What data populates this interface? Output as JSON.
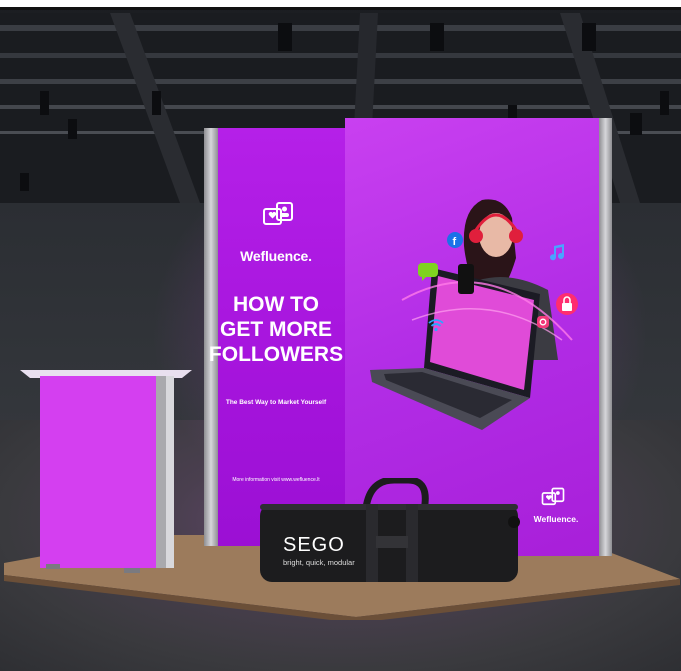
{
  "booth": {
    "brand_name": "Wefluence.",
    "headline_line1": "HOW TO",
    "headline_line2": "GET MORE",
    "headline_line3": "FOLLOWERS",
    "tagline": "The Best Way to Market Yourself",
    "more_info": "More information visit www.wefluence.lt",
    "brand_name_small": "Wefluence."
  },
  "bag": {
    "brand": "SEGO",
    "slogan": "bright, quick, modular"
  },
  "colors": {
    "panel_purple": "#b22de6",
    "counter_pink": "#d43ff0",
    "bag_black": "#1c1c1e",
    "floor_wood": "#9c7b5c"
  },
  "icons": [
    "chat-heart-icon",
    "facebook-icon",
    "music-note-icon",
    "lock-icon",
    "instagram-icon",
    "wifi-icon"
  ]
}
